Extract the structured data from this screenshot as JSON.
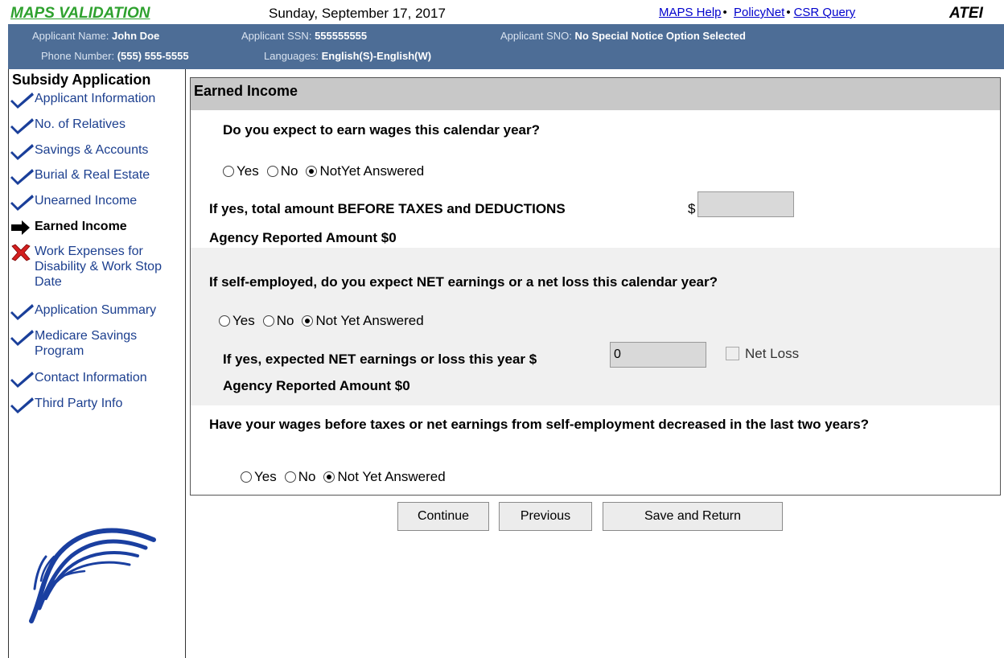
{
  "app": {
    "title": "MAPS VALIDATION",
    "date": "Sunday, September 17, 2017",
    "links": [
      "MAPS Help",
      "PolicyNet",
      "CSR Query"
    ],
    "code": "ATEI"
  },
  "applicant": {
    "name_label": "Applicant Name:",
    "name": "John Doe",
    "ssn_label": "Applicant SSN:",
    "ssn": "555555555",
    "sno_label": "Applicant SNO:",
    "sno": "No Special Notice Option Selected",
    "phone_label": "Phone Number:",
    "phone": "(555) 555-5555",
    "languages_label": "Languages:",
    "languages": "English(S)-English(W)"
  },
  "sidebar": {
    "title": "Subsidy Application",
    "items": [
      {
        "label": "Applicant Information",
        "status": "complete",
        "icon": "checkmark-icon"
      },
      {
        "label": "No. of Relatives",
        "status": "complete",
        "icon": "checkmark-icon"
      },
      {
        "label": "Savings & Accounts",
        "status": "complete",
        "icon": "checkmark-icon"
      },
      {
        "label": "Burial & Real Estate",
        "status": "complete",
        "icon": "checkmark-icon"
      },
      {
        "label": "Unearned Income",
        "status": "complete",
        "icon": "checkmark-icon"
      },
      {
        "label": "Earned Income",
        "status": "current",
        "icon": "arrow-right-icon"
      },
      {
        "label": "Work Expenses for Disability & Work Stop Date",
        "status": "incomplete",
        "icon": "x-icon"
      },
      {
        "label": "Application Summary",
        "status": "complete",
        "icon": "checkmark-icon"
      },
      {
        "label": "Medicare Savings Program",
        "status": "complete",
        "icon": "checkmark-icon"
      },
      {
        "label": "Contact Information",
        "status": "complete",
        "icon": "checkmark-icon"
      },
      {
        "label": "Third Party Info",
        "status": "complete",
        "icon": "checkmark-icon"
      }
    ]
  },
  "form": {
    "section_title": "Earned Income",
    "q1": {
      "question": "Do you expect to earn wages this calendar year?",
      "options": [
        "Yes",
        "No",
        "NotYet Answered"
      ],
      "selected": "NotYet Answered",
      "amount_label": "If yes, total amount BEFORE TAXES and DEDUCTIONS",
      "currency": "$",
      "amount_value": "",
      "agency_amount": "Agency Reported Amount $0"
    },
    "q2": {
      "question": "If self-employed, do you  expect NET earnings or a net loss this calendar year?",
      "options": [
        "Yes",
        "No",
        "Not Yet Answered"
      ],
      "selected": "Not Yet Answered",
      "amount_label": "If yes, expected NET earnings or loss this year $",
      "amount_value": "0",
      "net_loss_label": "Net Loss",
      "agency_amount": "Agency Reported Amount $0"
    },
    "q3": {
      "question": "Have your wages before taxes or net earnings from self-employment decreased in the last two years?",
      "options": [
        "Yes",
        "No",
        "Not Yet Answered"
      ],
      "selected": "Not Yet Answered"
    }
  },
  "buttons": {
    "continue": "Continue",
    "previous": "Previous",
    "save_return": "Save and Return"
  },
  "colors": {
    "title_green": "#2ea12e",
    "info_bar": "#4d6d96",
    "nav_link": "#1c3f8f",
    "check_blue": "#1a3f9a",
    "x_red": "#d42020"
  }
}
